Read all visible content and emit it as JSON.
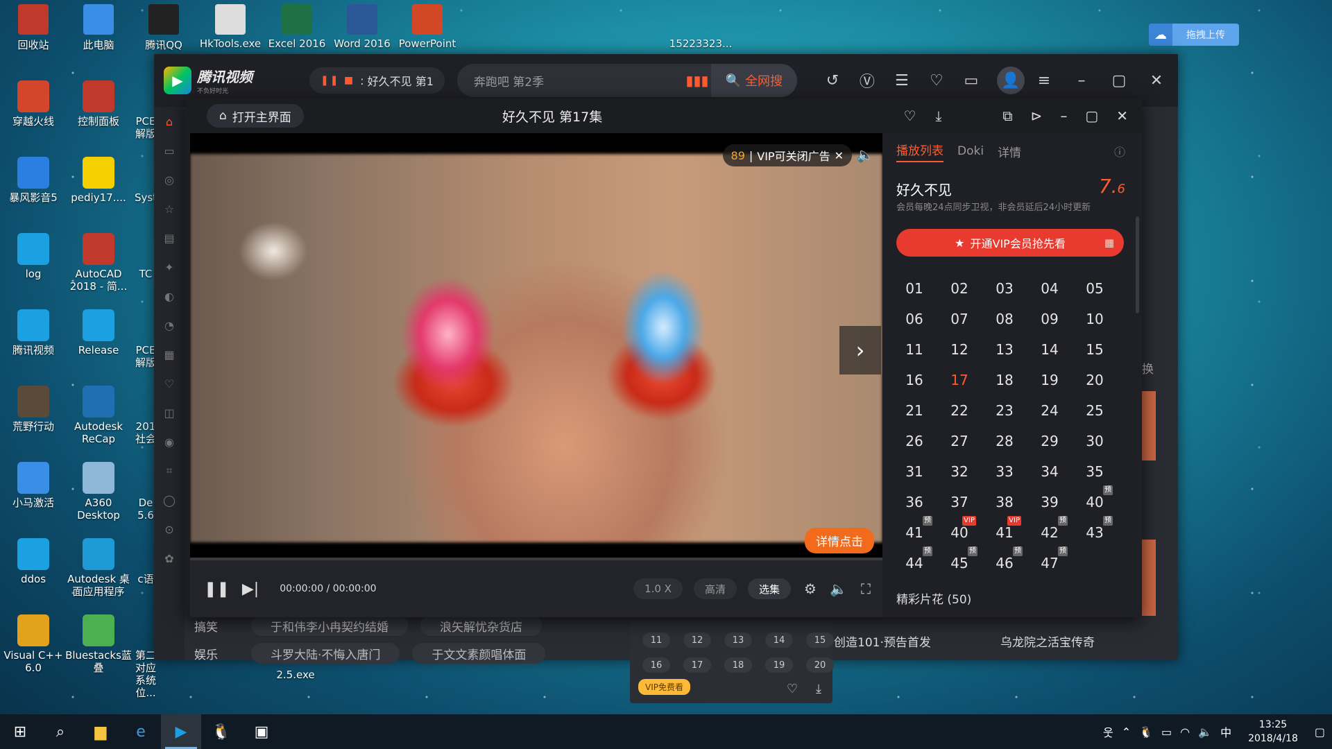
{
  "desktop": {
    "top_icons": [
      {
        "label": "回收站",
        "icon": "recycle-bin-icon",
        "color": "#c0392b"
      },
      {
        "label": "此电脑",
        "icon": "computer-icon",
        "color": "#3a8ee6"
      },
      {
        "label": "腾讯QQ",
        "icon": "qq-icon",
        "color": "#222222"
      },
      {
        "label": "HkTools.exe",
        "icon": "hktools-icon",
        "color": "#dddddd"
      },
      {
        "label": "Excel 2016",
        "icon": "excel-icon",
        "color": "#1e7145"
      },
      {
        "label": "Word 2016",
        "icon": "word-icon",
        "color": "#2b5797"
      },
      {
        "label": "PowerPoint",
        "icon": "powerpoint-icon",
        "color": "#d24726"
      }
    ],
    "top_extra": "15223323...",
    "left_col1": [
      {
        "label": "穿越火线",
        "icon": "cf-icon",
        "color": "#d4462c"
      },
      {
        "label": "暴风影音5",
        "icon": "baofeng-icon",
        "color": "#2a7fe0"
      },
      {
        "label": "log",
        "icon": "folder-icon",
        "color": "#1ba1e2"
      },
      {
        "label": "腾讯视频",
        "icon": "tencent-video-icon",
        "color": "#1ba1e2"
      },
      {
        "label": "荒野行动",
        "icon": "game-icon",
        "color": "#5a4a3a"
      },
      {
        "label": "小马激活",
        "icon": "horse-icon",
        "color": "#3a8ee6"
      },
      {
        "label": "ddos",
        "icon": "folder-icon",
        "color": "#1ba1e2"
      },
      {
        "label": "Visual C++ 6.0",
        "icon": "vc-icon",
        "color": "#e2a21b"
      }
    ],
    "left_col2": [
      {
        "label": "控制面板",
        "icon": "control-panel-icon",
        "color": "#c0392b"
      },
      {
        "label": "pediy17....",
        "icon": "pediy-icon",
        "color": "#f5d000"
      },
      {
        "label": "AutoCAD 2018 - 简...",
        "icon": "autocad-icon",
        "color": "#c0392b"
      },
      {
        "label": "Release",
        "icon": "folder-icon",
        "color": "#1ba1e2"
      },
      {
        "label": "Autodesk ReCap",
        "icon": "recap-icon",
        "color": "#1f6fb2"
      },
      {
        "label": "A360 Desktop",
        "icon": "a360-icon",
        "color": "#8fb8d8"
      },
      {
        "label": "Autodesk 桌面应用程序",
        "icon": "autodesk-icon",
        "color": "#1e9bd7"
      },
      {
        "label": "Bluestacks蓝叠",
        "icon": "bluestacks-icon",
        "color": "#4caf50"
      }
    ],
    "left_col3": [
      "PCE 解版",
      "Syst",
      "TC",
      "PCE 解版",
      "201 社会",
      "De 5.6",
      "c语",
      "第二 对应系统位..."
    ],
    "extra_text": "2.5.exe",
    "upload_label": "拖拽上传"
  },
  "app": {
    "logo_text": "腾讯视频",
    "logo_sub": "不负好时光",
    "now_playing": "好久不见 第1",
    "search_placeholder": "奔跑吧 第2季",
    "search_button": "全网搜",
    "sidebar_icons": [
      "home-icon",
      "tv-icon",
      "film-icon",
      "star-icon",
      "game-icon",
      "anime-icon",
      "music-icon",
      "sports-icon",
      "doc-icon",
      "kids-icon",
      "fashion-icon",
      "news-icon",
      "tag-icon",
      "circle-icon",
      "car-icon",
      "dance-icon"
    ],
    "below_rows": [
      {
        "category": "搞笑",
        "items": [
          "于和伟李小冉契约结婚",
          "浪矢解忧杂货店"
        ]
      },
      {
        "category": "娱乐",
        "items": [
          "斗罗大陆·不悔入唐门",
          "于文文素颜唱体面"
        ]
      }
    ],
    "right_titles": [
      "创造101·预告首发",
      "乌龙院之活宝传奇"
    ],
    "side_label": "换",
    "mini_popup": {
      "episodes": [
        "11",
        "12",
        "13",
        "14",
        "15",
        "16",
        "17",
        "18",
        "19",
        "20"
      ],
      "vip_label": "VIP免费看"
    }
  },
  "player": {
    "home_button": "打开主界面",
    "title": "好久不见 第17集",
    "ad_count": "89",
    "ad_text": "VIP可关闭广告",
    "detail_button": "详情点击",
    "time": "00:00:00 / 00:00:00",
    "speed": "1.0 X",
    "quality": "高清",
    "select": "选集",
    "panel": {
      "tabs": [
        "播放列表",
        "Doki",
        "详情"
      ],
      "show_title": "好久不见",
      "score_int": "7.",
      "score_dec": "6",
      "desc": "会员每晚24点同步卫视，非会员延后24小时更新",
      "vip_button": "开通VIP会员抢先看",
      "current_episode": "17",
      "episodes": [
        {
          "n": "01"
        },
        {
          "n": "02"
        },
        {
          "n": "03"
        },
        {
          "n": "04"
        },
        {
          "n": "05"
        },
        {
          "n": "06"
        },
        {
          "n": "07"
        },
        {
          "n": "08"
        },
        {
          "n": "09"
        },
        {
          "n": "10"
        },
        {
          "n": "11"
        },
        {
          "n": "12"
        },
        {
          "n": "13"
        },
        {
          "n": "14"
        },
        {
          "n": "15"
        },
        {
          "n": "16"
        },
        {
          "n": "17"
        },
        {
          "n": "18"
        },
        {
          "n": "19"
        },
        {
          "n": "20"
        },
        {
          "n": "21"
        },
        {
          "n": "22"
        },
        {
          "n": "23"
        },
        {
          "n": "24"
        },
        {
          "n": "25"
        },
        {
          "n": "26"
        },
        {
          "n": "27"
        },
        {
          "n": "28"
        },
        {
          "n": "29"
        },
        {
          "n": "30"
        },
        {
          "n": "31"
        },
        {
          "n": "32"
        },
        {
          "n": "33"
        },
        {
          "n": "34"
        },
        {
          "n": "35"
        },
        {
          "n": "36"
        },
        {
          "n": "37"
        },
        {
          "n": "38"
        },
        {
          "n": "39"
        },
        {
          "n": "40",
          "tag": "预"
        },
        {
          "n": "41",
          "tag": "预"
        },
        {
          "n": "40",
          "tag": "VIP"
        },
        {
          "n": "41",
          "tag": "VIP"
        },
        {
          "n": "42",
          "tag": "预"
        },
        {
          "n": "43",
          "tag": "预"
        },
        {
          "n": "44",
          "tag": "预"
        },
        {
          "n": "45",
          "tag": "预"
        },
        {
          "n": "46",
          "tag": "预"
        },
        {
          "n": "47",
          "tag": "预"
        }
      ],
      "highlights": "精彩片花 (50)"
    }
  },
  "taskbar": {
    "time": "13:25",
    "date": "2018/4/18",
    "ime": "中"
  },
  "colors": {
    "accent": "#ff5b30",
    "vip_red": "#e83a2e",
    "detail_orange": "#f26a1b"
  }
}
